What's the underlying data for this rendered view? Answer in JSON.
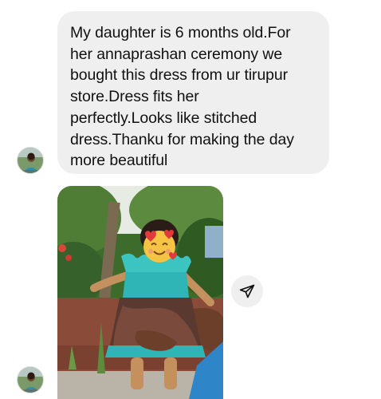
{
  "message": {
    "text": "My daughter is 6 months old.For\nher annaprashan ceremony we\nbought this dress from ur tirupur\nstore.Dress fits her\nperfectly.Looks like stitched\ndress.Thanku  for making the day\nmore beautiful"
  },
  "icons": {
    "share": "paper-plane-icon",
    "avatar": "user-avatar",
    "emoji_sticker": "smiling-face-with-hearts-emoji"
  },
  "colors": {
    "bubble": "#efefef",
    "text": "#111111"
  }
}
